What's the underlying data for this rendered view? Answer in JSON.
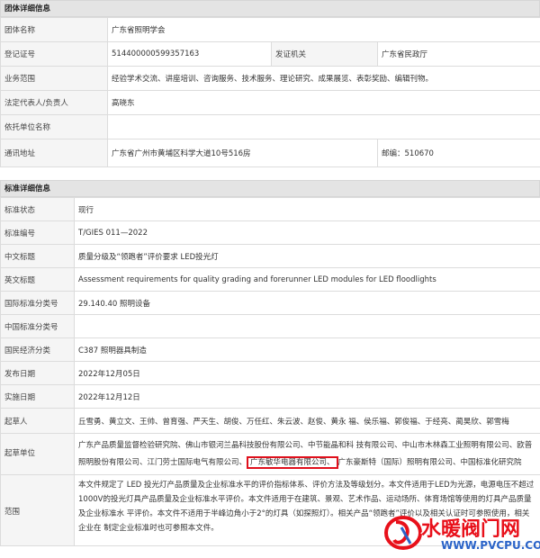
{
  "group": {
    "title": "团体详细信息",
    "name_label": "团体名称",
    "name": "广东省照明学会",
    "reg_label": "登记证号",
    "reg_no": "514400000599357163",
    "issuer_label": "发证机关",
    "issuer": "广东省民政厅",
    "scope_label": "业务范围",
    "scope": "经验学术交流、讲座培训、咨询服务、技术服务、理论研究、成果展览、表彰奖励、编辑刊物。",
    "rep_label": "法定代表人/负责人",
    "rep": "高晓东",
    "dep_label": "依托单位名称",
    "dep": "",
    "addr_label": "通讯地址",
    "addr": "广东省广州市黄埔区科学大道10号516房",
    "postcode": "邮编：510670"
  },
  "standard": {
    "title": "标准详细信息",
    "status_label": "标准状态",
    "status": "现行",
    "code_label": "标准编号",
    "code": "T/GIES 011—2022",
    "cn_title_label": "中文标题",
    "cn_title": "质量分级及“领跑者”评价要求 LED投光灯",
    "en_title_label": "英文标题",
    "en_title": "Assessment requirements for quality grading and forerunner LED modules for LED floodlights",
    "ics_label": "国际标准分类号",
    "ics": "29.140.40 照明设备",
    "ccs_label": "中国标准分类号",
    "ccs": "",
    "econ_label": "国民经济分类",
    "econ": "C387 照明器具制造",
    "pub_label": "发布日期",
    "pub_date": "2022年12月05日",
    "impl_label": "实施日期",
    "impl_date": "2022年12月12日",
    "drafters_label": "起草人",
    "drafters": "丘雪勇、黄立文、王帅、曾育强、严天生、胡俊、万任红、朱云波、赵俊、黄永 福、侯乐福、郭俊福、于经亮、蔺昊欣、郭雪梅",
    "units_label": "起草单位",
    "units_part1": "广东产品质量监督检验研究院、佛山市银河兰晶科技股份有限公司、中节能晶和科 技有限公司、中山市木林森工业照明有限公司、欧普照明股份有限公司、江门劳士国际电气有限公司、",
    "units_highlight": "广东敏华电器有限公司、",
    "units_part2": "广东豪斯特（国际）照明有限公司、中国标准化研究院",
    "scope_label": "范围",
    "scope_text": "本文件规定了 LED 投光灯产品质量及企业标准水平的评价指标体系、评价方法及等级划分。本文件适用于LED为光源，电源电压不超过1000V的投光灯具产品质量及企业标准水平评价。本文件适用于在建筑、景观、艺术作品、运动场所、体育场馆等使用的灯具产品质量及企业标准水 平评价。本文件不适用于半峰边角小于2°的灯具（如探照灯）。相关产品“领跑者”评价以及相关认证时可参照使用，相关企业在 制定企业标准时也可参照本文件。"
  },
  "watermark": {
    "cn": "水暖阀门网",
    "en": "WWW.PVCPU.COM"
  }
}
